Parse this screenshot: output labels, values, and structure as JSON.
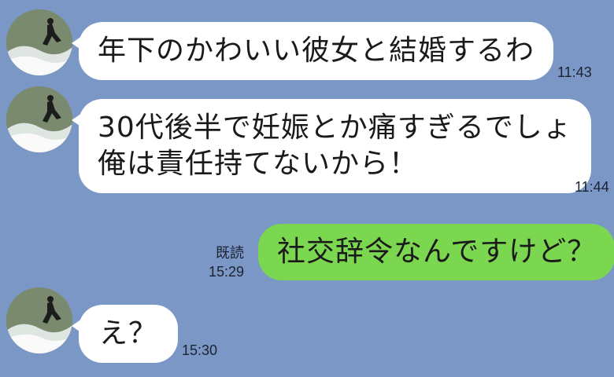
{
  "messages": [
    {
      "side": "in",
      "lines": [
        "年下のかわいい彼女と結婚するわ"
      ],
      "time": "11:43"
    },
    {
      "side": "in",
      "lines": [
        "30代後半で妊娠とか痛すぎるでしょ",
        "俺は責任持てないから！"
      ],
      "time": "11:44"
    },
    {
      "side": "out",
      "lines": [
        "社交辞令なんですけど？"
      ],
      "read": "既読",
      "time": "15:29"
    },
    {
      "side": "in",
      "lines": [
        "え？"
      ],
      "time": "15:30"
    }
  ],
  "colors": {
    "background": "#7b97c5",
    "incoming_bubble": "#ffffff",
    "outgoing_bubble": "#7bd650"
  },
  "avatar_icon": "surfer-photo-icon"
}
